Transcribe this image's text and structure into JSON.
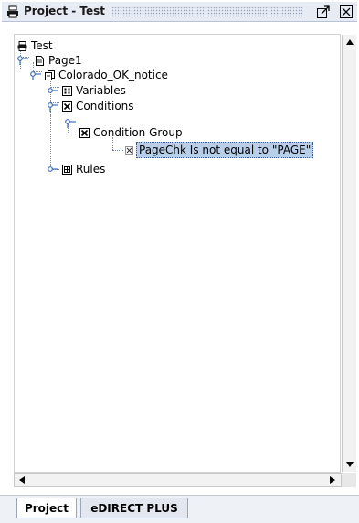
{
  "panel": {
    "title": "Project - Test",
    "icons": {
      "app": "printer-icon",
      "float": "float-window-icon",
      "close": "close-icon"
    }
  },
  "tree": {
    "root": "Test",
    "page": "Page1",
    "notice": "Colorado_OK_notice",
    "variables": "Variables",
    "conditions": "Conditions",
    "condition_group": "Condition Group",
    "condition": "PageChk Is not equal to \"PAGE\"",
    "rules": "Rules"
  },
  "tabs": [
    {
      "label": "Project",
      "active": true
    },
    {
      "label": "eDIRECT PLUS",
      "active": false
    }
  ],
  "colors": {
    "selection": "#b9cfe9",
    "titlebar": "#e6ebf4"
  }
}
